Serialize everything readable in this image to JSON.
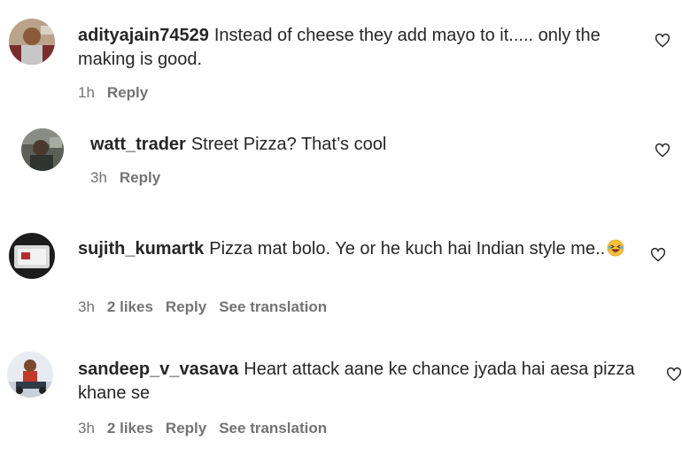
{
  "comments": [
    {
      "username": "adityajain74529",
      "text": "Instead of cheese they add mayo to it..... only the making is good.",
      "time": "1h",
      "likes": "",
      "reply_label": "Reply",
      "translate_label": "",
      "avatar_icon": "avatar-photo"
    },
    {
      "username": "watt_trader",
      "text": "Street Pizza? That’s cool",
      "time": "3h",
      "likes": "",
      "reply_label": "Reply",
      "translate_label": "",
      "avatar_icon": "avatar-photo"
    },
    {
      "username": "sujith_kumartk",
      "text": "Pizza mat bolo. Ye or he kuch hai Indian style me..",
      "time": "3h",
      "likes": "2 likes",
      "reply_label": "Reply",
      "translate_label": "See translation",
      "emoji_icon": "laughing-emoji-icon",
      "avatar_icon": "avatar-photo"
    },
    {
      "username": "sandeep_v_vasava",
      "text": "Heart attack aane ke chance jyada hai aesa pizza khane se",
      "time": "3h",
      "likes": "2 likes",
      "reply_label": "Reply",
      "translate_label": "See translation",
      "avatar_icon": "avatar-photo"
    }
  ],
  "colors": {
    "text": "#262626",
    "meta": "#737373",
    "background": "#ffffff"
  }
}
